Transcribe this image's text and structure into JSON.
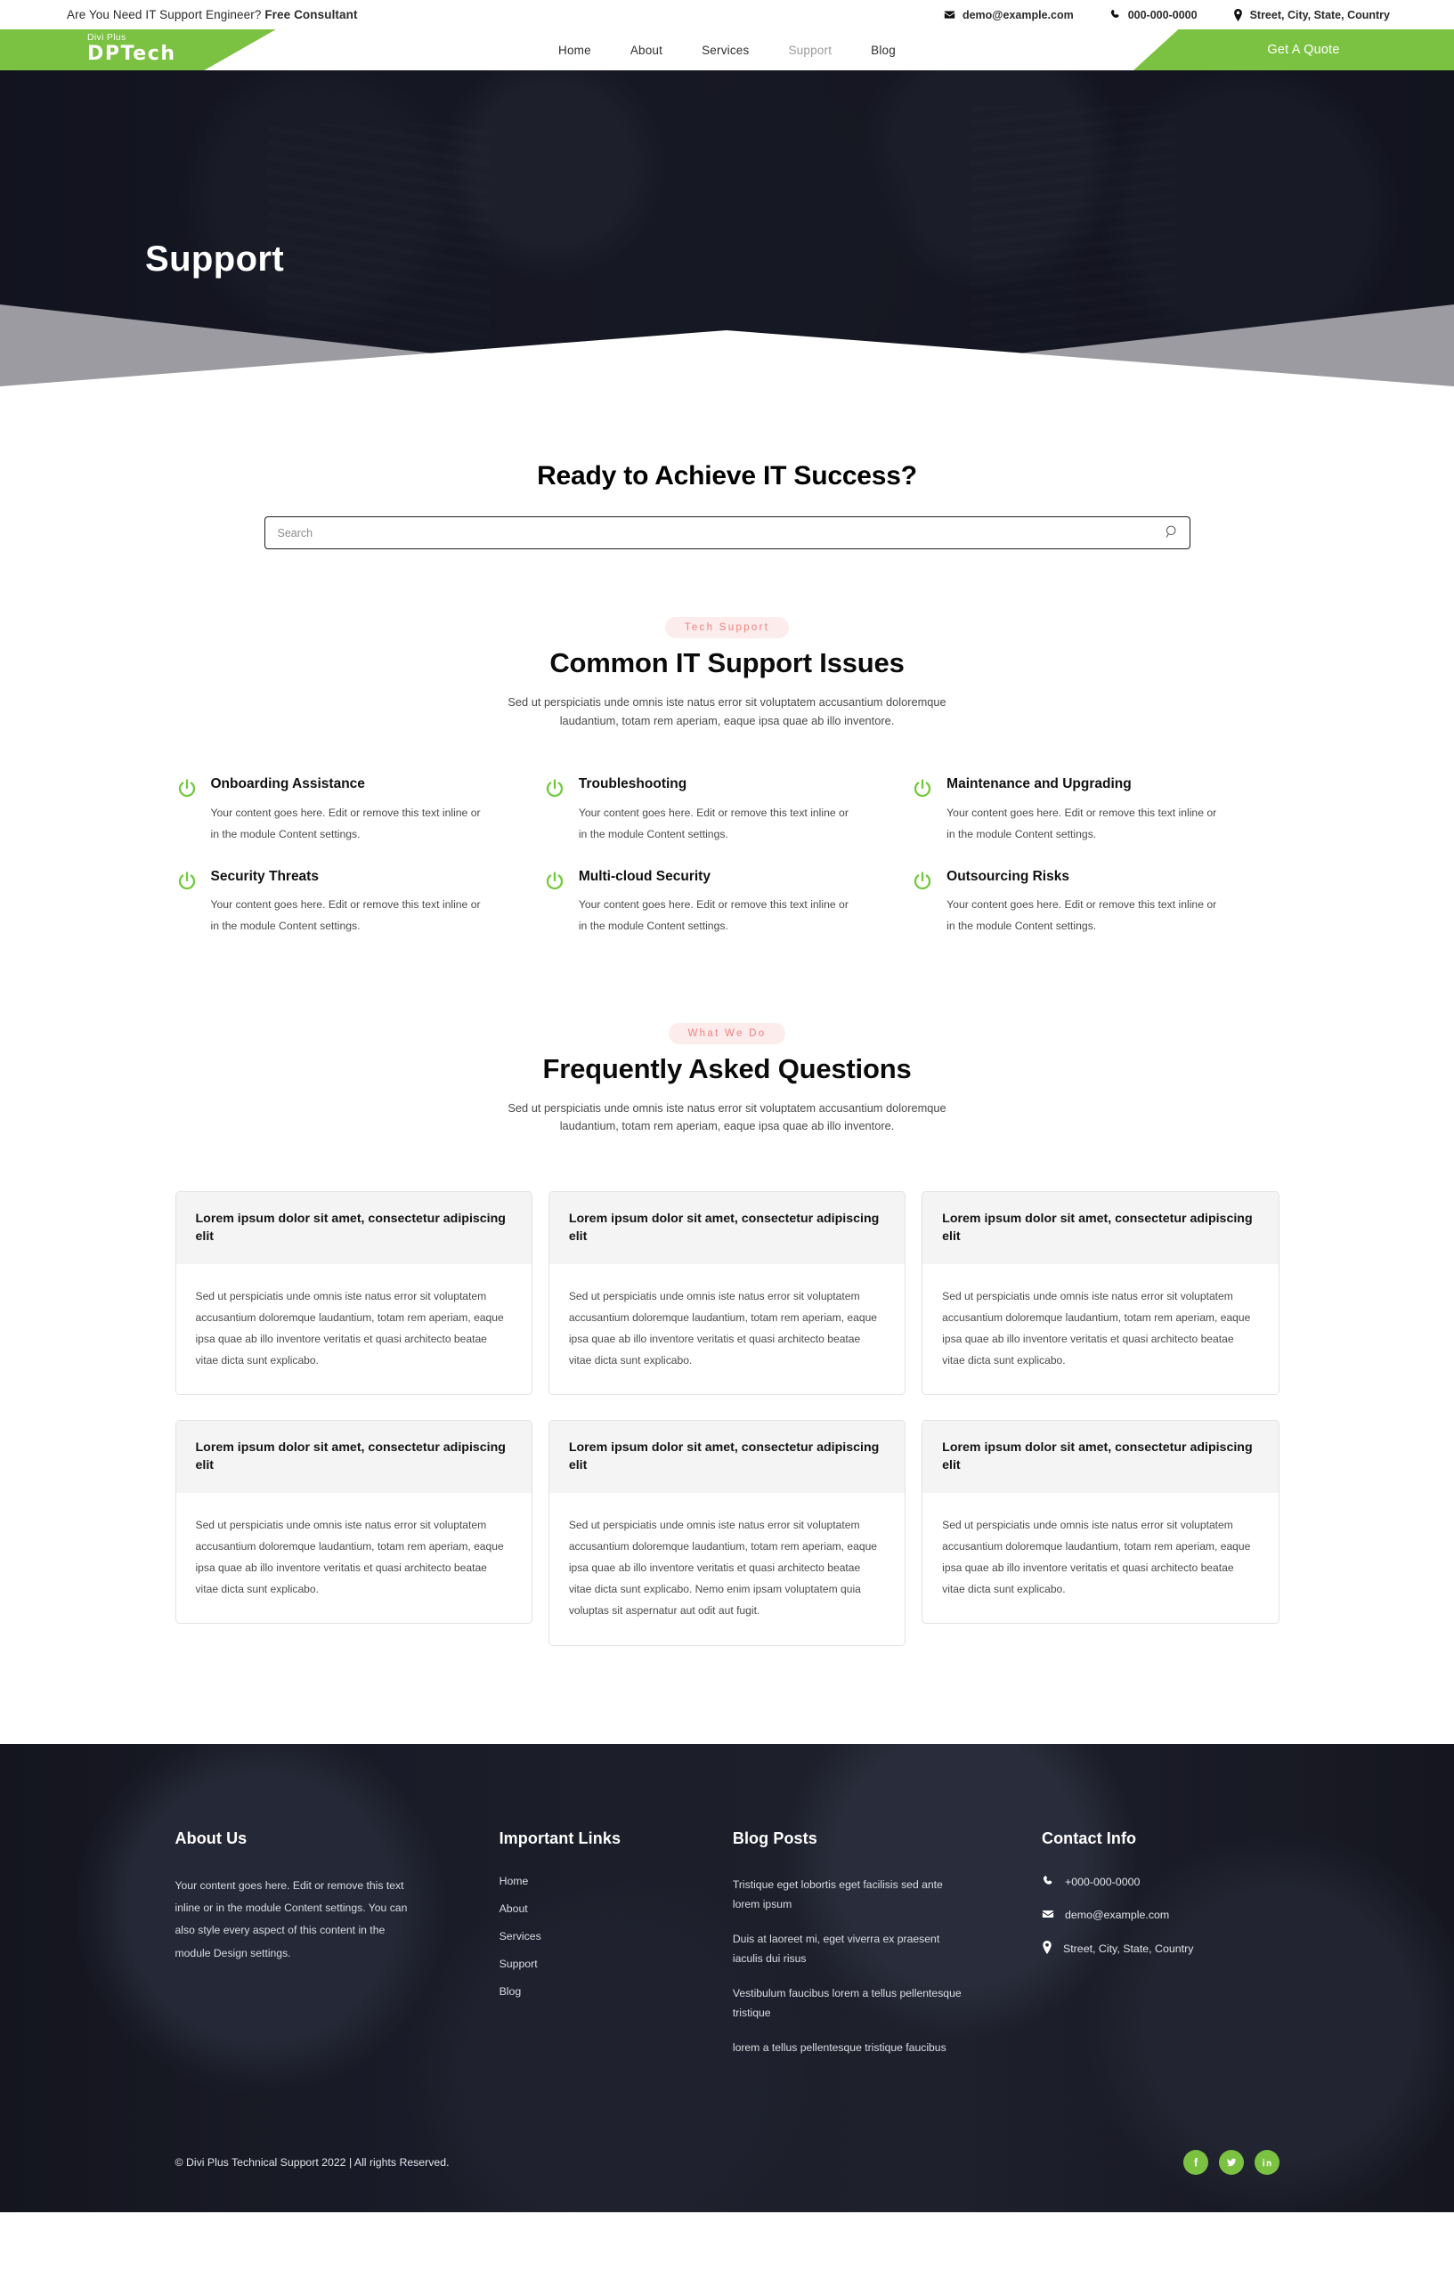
{
  "topbar": {
    "tagline_plain": "Are You Need IT Support Engineer? ",
    "tagline_bold": "Free Consultant",
    "email": "demo@example.com",
    "phone": "000-000-0000",
    "address": "Street, City, State, Country"
  },
  "header": {
    "logo_small": "Divi Plus",
    "logo_big": "DPTech",
    "cta": "Get A Quote",
    "nav": [
      {
        "label": "Home",
        "active": false
      },
      {
        "label": "About",
        "active": false
      },
      {
        "label": "Services",
        "active": false
      },
      {
        "label": "Support",
        "active": true
      },
      {
        "label": "Blog",
        "active": false
      }
    ]
  },
  "hero": {
    "title": "Support"
  },
  "search": {
    "title": "Ready to Achieve IT Success?",
    "placeholder": "Search",
    "value": ""
  },
  "issues": {
    "badge": "Tech Support",
    "title": "Common IT Support Issues",
    "subtitle": "Sed ut perspiciatis unde omnis iste natus error sit voluptatem accusantium doloremque laudantium, totam rem aperiam, eaque ipsa quae ab illo inventore.",
    "items": [
      {
        "title": "Onboarding Assistance",
        "text": "Your content goes here. Edit or remove this text inline or in the module Content settings."
      },
      {
        "title": "Troubleshooting",
        "text": "Your content goes here. Edit or remove this text inline or in the module Content settings."
      },
      {
        "title": "Maintenance and Upgrading",
        "text": "Your content goes here. Edit or remove this text inline or in the module Content settings."
      },
      {
        "title": "Security Threats",
        "text": "Your content goes here. Edit or remove this text inline or in the module Content settings."
      },
      {
        "title": "Multi-cloud Security",
        "text": "Your content goes here. Edit or remove this text inline or in the module Content settings."
      },
      {
        "title": "Outsourcing Risks",
        "text": "Your content goes here. Edit or remove this text inline or in the module Content settings."
      }
    ]
  },
  "faq": {
    "badge": "What We Do",
    "title": "Frequently Asked Questions",
    "subtitle": "Sed ut perspiciatis unde omnis iste natus error sit voluptatem accusantium doloremque laudantium, totam rem aperiam, eaque ipsa quae ab illo inventore.",
    "cards": [
      {
        "question": "Lorem ipsum dolor sit amet, consectetur adipiscing elit",
        "answer": "Sed ut perspiciatis unde omnis iste natus error sit voluptatem accusantium doloremque laudantium, totam rem aperiam, eaque ipsa quae ab illo inventore veritatis et quasi architecto beatae vitae dicta sunt explicabo."
      },
      {
        "question": "Lorem ipsum dolor sit amet, consectetur adipiscing elit",
        "answer": "Sed ut perspiciatis unde omnis iste natus error sit voluptatem accusantium doloremque laudantium, totam rem aperiam, eaque ipsa quae ab illo inventore veritatis et quasi architecto beatae vitae dicta sunt explicabo."
      },
      {
        "question": "Lorem ipsum dolor sit amet, consectetur adipiscing elit",
        "answer": "Sed ut perspiciatis unde omnis iste natus error sit voluptatem accusantium doloremque laudantium, totam rem aperiam, eaque ipsa quae ab illo inventore veritatis et quasi architecto beatae vitae dicta sunt explicabo."
      },
      {
        "question": "Lorem ipsum dolor sit amet, consectetur adipiscing elit",
        "answer": "Sed ut perspiciatis unde omnis iste natus error sit voluptatem accusantium doloremque laudantium, totam rem aperiam, eaque ipsa quae ab illo inventore veritatis et quasi architecto beatae vitae dicta sunt explicabo."
      },
      {
        "question": "Lorem ipsum dolor sit amet, consectetur adipiscing elit",
        "answer": "Sed ut perspiciatis unde omnis iste natus error sit voluptatem accusantium doloremque laudantium, totam rem aperiam, eaque ipsa quae ab illo inventore veritatis et quasi architecto beatae vitae dicta sunt explicabo. Nemo enim ipsam voluptatem quia voluptas sit aspernatur aut odit aut fugit."
      },
      {
        "question": "Lorem ipsum dolor sit amet, consectetur adipiscing elit",
        "answer": "Sed ut perspiciatis unde omnis iste natus error sit voluptatem accusantium doloremque laudantium, totam rem aperiam, eaque ipsa quae ab illo inventore veritatis et quasi architecto beatae vitae dicta sunt explicabo."
      }
    ]
  },
  "footer": {
    "about": {
      "heading": "About Us",
      "text": "Your content goes here. Edit or remove this text inline or in the module Content settings. You can also style every aspect of this content in the module Design settings."
    },
    "links": {
      "heading": "Important Links",
      "items": [
        "Home",
        "About",
        "Services",
        "Support",
        "Blog"
      ]
    },
    "posts": {
      "heading": "Blog Posts",
      "items": [
        "Tristique eget lobortis eget facilisis sed ante lorem ipsum",
        "Duis at laoreet mi, eget viverra ex praesent iaculis dui risus",
        "Vestibulum faucibus lorem a tellus pellentesque tristique",
        "lorem a tellus pellentesque tristique faucibus"
      ]
    },
    "contact": {
      "heading": "Contact Info",
      "phone": "+000-000-0000",
      "email": "demo@example.com",
      "address": "Street, City, State, Country"
    },
    "copyright": "© Divi Plus Technical Support 2022 | All rights Reserved.",
    "socials": [
      "facebook-icon",
      "twitter-icon",
      "linkedin-icon"
    ]
  },
  "colors": {
    "brand_green": "#7cc242",
    "badge_bg": "#fdecec",
    "badge_text": "#f08080",
    "footer_bg": "#181a28"
  }
}
